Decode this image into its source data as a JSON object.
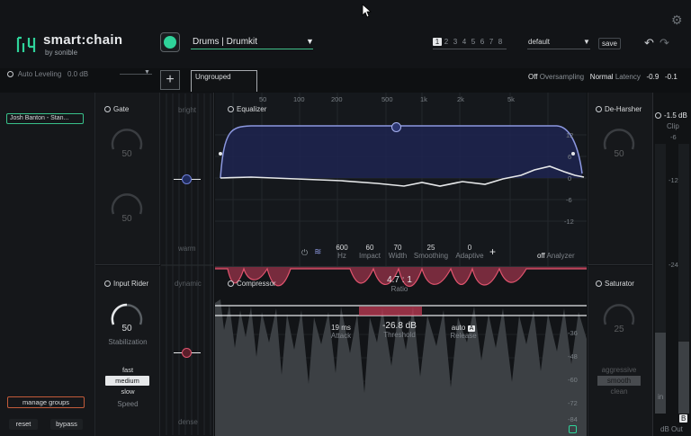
{
  "header": {
    "brand_name": "smart:chain",
    "brand_by": "by sonible",
    "preset_name": "Drums | Drumkit",
    "slots": [
      "1",
      "2",
      "3",
      "4",
      "5",
      "6",
      "7",
      "8"
    ],
    "active_slot": "1",
    "preset_bank": "default",
    "save_label": "save",
    "undo_icon": "undo-icon",
    "redo_icon": "redo-icon",
    "settings_icon": "gear-icon"
  },
  "auto_leveling": {
    "label": "Auto Leveling",
    "value": "0.0 dB"
  },
  "groups": {
    "add_label": "+",
    "tab_label": "Ungrouped"
  },
  "status": {
    "oversampling_state": "Off",
    "oversampling_label": "Oversampling",
    "latency_mode": "Normal",
    "latency_label": "Latency",
    "level_left": "-0.9",
    "level_right": "-0.1"
  },
  "sidebar": {
    "track_name": "Josh Banton - Stan...",
    "manage_groups": "manage groups",
    "reset": "reset",
    "bypass": "bypass"
  },
  "gate": {
    "title": "Gate",
    "knob1_value": "50",
    "knob2_value": "50"
  },
  "input_rider": {
    "title": "Input Rider",
    "value": "50",
    "label": "Stabilization",
    "speed_options": [
      "fast",
      "medium",
      "slow"
    ],
    "speed_selected": "medium",
    "speed_label": "Speed"
  },
  "balance": {
    "top_label": "bright",
    "mid_label": "warm",
    "dyn_label": "dynamic",
    "dense_label": "dense"
  },
  "equalizer": {
    "title": "Equalizer",
    "freq_ticks": [
      "50",
      "100",
      "200",
      "500",
      "1k",
      "2k",
      "5k"
    ],
    "db_ticks": [
      "12",
      "6",
      "0",
      "-6",
      "-12"
    ],
    "params": [
      {
        "value": "600",
        "label": "Hz"
      },
      {
        "value": "60",
        "label": "Impact"
      },
      {
        "value": "70",
        "label": "Width"
      },
      {
        "value": "25",
        "label": "Smoothing"
      },
      {
        "value": "0",
        "label": "Adaptive"
      }
    ],
    "analyzer_state": "off",
    "analyzer_label": "Analyzer"
  },
  "compressor": {
    "title": "Compressor",
    "ratio": "4.7 : 1",
    "ratio_label": "Ratio",
    "attack": "19 ms",
    "attack_label": "Attack",
    "threshold": "-26.8 dB",
    "threshold_label": "Threshold",
    "release": "auto",
    "release_badge": "A",
    "release_label": "Release",
    "db_ticks": [
      "-36",
      "-48",
      "-60",
      "-72",
      "-84"
    ]
  },
  "de_harsher": {
    "title": "De-Harsher",
    "value": "50"
  },
  "saturator": {
    "title": "Saturator",
    "value": "25",
    "style_top": "aggressive",
    "style_selected": "smooth",
    "style_bottom": "clean"
  },
  "output": {
    "clip_value": "-1.5 dB",
    "clip_label": "Clip",
    "scale": [
      "-6",
      "-12",
      "-24"
    ],
    "in_label": "in",
    "out_label": "dB Out",
    "badge": "B"
  },
  "colors": {
    "accent_green": "#2fd39a",
    "eq_curve": "#9aa8e8",
    "comp_red": "#e0546e",
    "manage_border": "#c25b3a"
  }
}
